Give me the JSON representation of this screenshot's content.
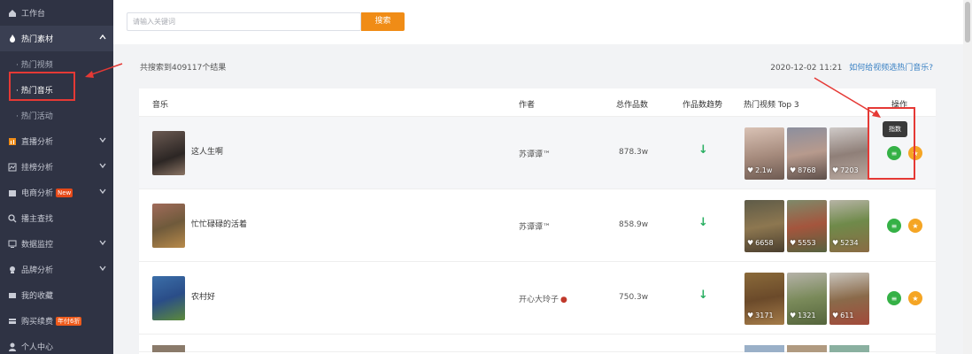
{
  "sidebar": {
    "items": [
      {
        "label": "工作台",
        "icon": "home-icon"
      },
      {
        "label": "热门素材",
        "icon": "fire-icon"
      },
      {
        "label": "直播分析",
        "icon": "chart-icon"
      },
      {
        "label": "挂榜分析",
        "icon": "bar-icon"
      },
      {
        "label": "电商分析",
        "icon": "cart-icon",
        "badge": "New"
      },
      {
        "label": "播主查找",
        "icon": "search-icon"
      },
      {
        "label": "数据监控",
        "icon": "monitor-icon"
      },
      {
        "label": "品牌分析",
        "icon": "brand-icon"
      },
      {
        "label": "我的收藏",
        "icon": "collection-icon"
      },
      {
        "label": "购买续费",
        "icon": "card-icon",
        "badge": "年付6折"
      },
      {
        "label": "个人中心",
        "icon": "user-icon"
      }
    ],
    "sub_items": [
      "· 热门视频",
      "· 热门音乐",
      "· 热门活动"
    ]
  },
  "search": {
    "placeholder": "请输入关键词",
    "button": "搜索"
  },
  "meta": {
    "result_count": "共搜索到409117个结果",
    "timestamp": "2020-12-02 11:21",
    "help_link": "如何给视频选热门音乐?"
  },
  "table": {
    "headers": [
      "音乐",
      "作者",
      "总作品数",
      "作品数趋势",
      "热门视频 Top 3",
      "操作"
    ],
    "rows": [
      {
        "song": "这人生啊",
        "author": "苏谭谭™",
        "total": "878.3w",
        "trend": "↓",
        "likes": [
          "2.1w",
          "8768",
          "7203"
        ]
      },
      {
        "song": "忙忙碌碌的活着",
        "author": "苏谭谭™",
        "total": "858.9w",
        "trend": "↓",
        "likes": [
          "6658",
          "5553",
          "5234"
        ]
      },
      {
        "song": "农村好",
        "author": "开心大玲子",
        "total": "750.3w",
        "trend": "↓",
        "likes": [
          "3171",
          "1321",
          "611"
        ]
      }
    ]
  },
  "tooltip": "指数",
  "colors": {
    "sidebar_bg": "#2f3344",
    "accent": "#f08c16",
    "trend_down": "#27ae60",
    "highlight": "#e53935"
  }
}
